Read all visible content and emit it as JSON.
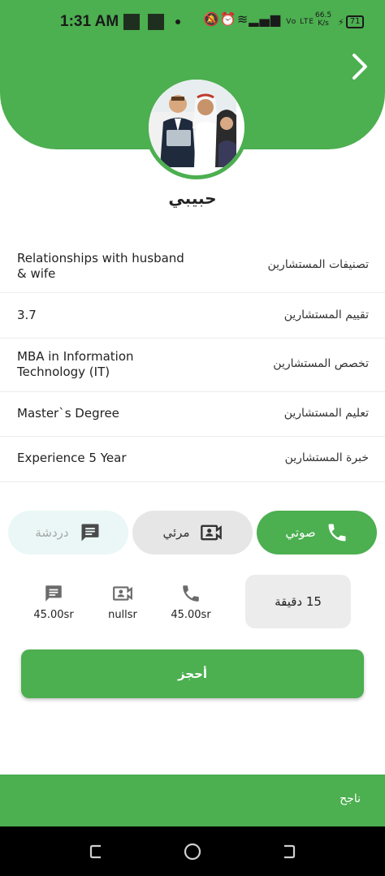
{
  "status_bar": {
    "time": "1:31 AM",
    "net_speed_value": "66.5",
    "net_speed_unit": "K/s",
    "battery": "71",
    "volte": "Vo LTE"
  },
  "profile": {
    "name": "حبيبي"
  },
  "details": [
    {
      "label": "تصنيفات المستشارين",
      "value": "Relationships with husband & wife"
    },
    {
      "label": "تقييم المستشارين",
      "value": "3.7"
    },
    {
      "label": "تخصص المستشارين",
      "value": "MBA in Information Technology (IT)"
    },
    {
      "label": "تعليم المستشارين",
      "value": "Master`s Degree"
    },
    {
      "label": "خبرة المستشارين",
      "value": "Experience 5 Year"
    }
  ],
  "consult_modes": {
    "voice": "صوتي",
    "video": "مرئي",
    "chat": "دردشة",
    "selected": "voice"
  },
  "prices": {
    "voice": "45.00sr",
    "video": "nullsr",
    "chat": "45.00sr"
  },
  "duration": "15 دقيقة",
  "book_button": "أحجز",
  "snackbar": "ناجح",
  "colors": {
    "primary": "#4caf50",
    "chat_bg": "#eaf7f6",
    "video_bg": "#e6e6e6"
  },
  "icons": [
    "chevron-right-icon",
    "phone-icon",
    "video-icon",
    "chat-icon"
  ]
}
